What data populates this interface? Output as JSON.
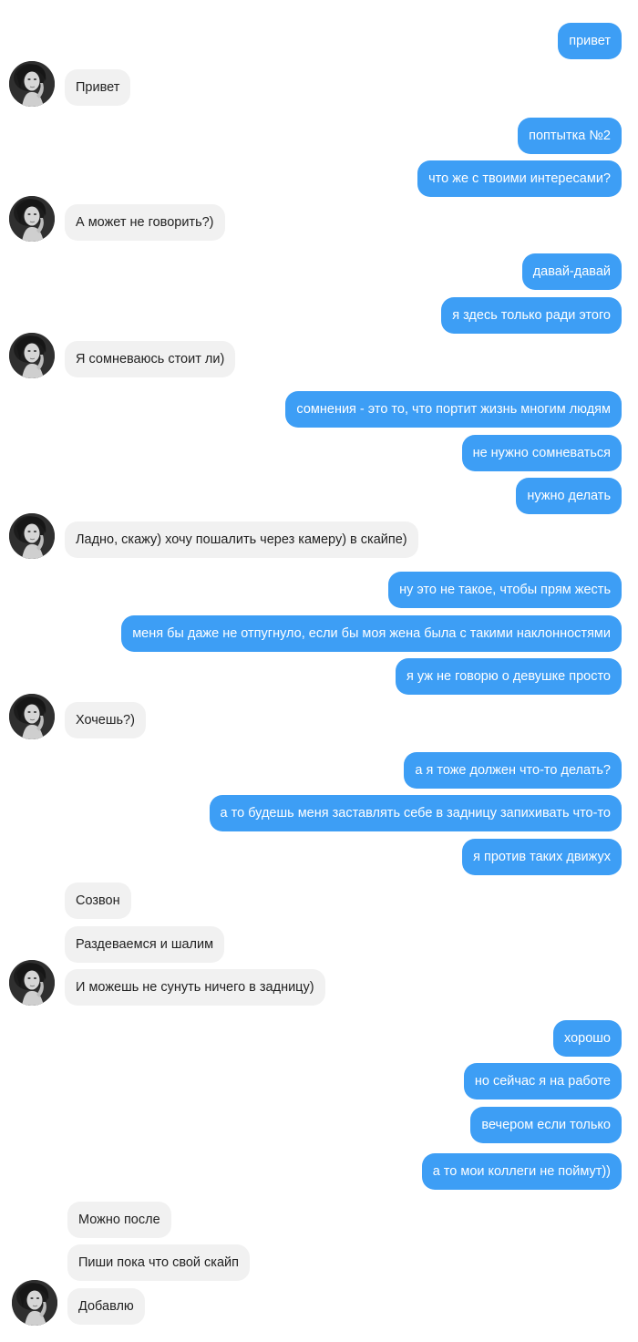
{
  "colors": {
    "outgoing": "#3d9ef5",
    "incoming": "#f1f1f1"
  },
  "messages": [
    {
      "side": "out",
      "text": "привет"
    },
    {
      "side": "in",
      "text": "Привет"
    },
    {
      "side": "out",
      "text": "поптытка №2"
    },
    {
      "side": "out",
      "text": "что же с твоими интересами?"
    },
    {
      "side": "in",
      "text": "А может не говорить?)"
    },
    {
      "side": "out",
      "text": "давай-давай"
    },
    {
      "side": "out",
      "text": "я здесь только ради этого"
    },
    {
      "side": "in",
      "text": "Я сомневаюсь стоит ли)"
    },
    {
      "side": "out",
      "text": "сомнения - это то, что портит жизнь многим людям"
    },
    {
      "side": "out",
      "text": "не нужно сомневаться"
    },
    {
      "side": "out",
      "text": "нужно делать"
    },
    {
      "side": "in",
      "text": "Ладно, скажу) хочу пошалить через камеру) в скайпе)"
    },
    {
      "side": "out",
      "text": "ну это не такое, чтобы прям жесть"
    },
    {
      "side": "out",
      "text": "меня бы даже не отпугнуло, если бы моя жена была с такими наклонностями"
    },
    {
      "side": "out",
      "text": "я уж не говорю о девушке просто"
    },
    {
      "side": "in",
      "text": "Хочешь?)"
    },
    {
      "side": "out",
      "text": "а я тоже должен что-то делать?"
    },
    {
      "side": "out",
      "text": "а то будешь меня заставлять себе в задницу запихивать что-то"
    },
    {
      "side": "out",
      "text": "я против таких движух"
    },
    {
      "side": "in",
      "text": "Созвон"
    },
    {
      "side": "in",
      "text": "Раздеваемся и шалим"
    },
    {
      "side": "in",
      "text": "И можешь не сунуть ничего в задницу)"
    },
    {
      "side": "out",
      "text": "хорошо"
    },
    {
      "side": "out",
      "text": "но сейчас я на работе"
    },
    {
      "side": "out",
      "text": "вечером если только"
    },
    {
      "side": "out",
      "text": "а то мои коллеги не поймут))"
    },
    {
      "side": "in",
      "text": "Можно после"
    },
    {
      "side": "in",
      "text": "Пиши пока что свой скайп"
    },
    {
      "side": "in",
      "text": "Добавлю"
    }
  ],
  "avatars": [
    {
      "name": "contact-avatar",
      "icon": "user-photo"
    },
    {
      "name": "contact-avatar",
      "icon": "user-photo"
    },
    {
      "name": "contact-avatar",
      "icon": "user-photo"
    },
    {
      "name": "contact-avatar",
      "icon": "user-photo"
    },
    {
      "name": "contact-avatar",
      "icon": "user-photo"
    },
    {
      "name": "contact-avatar",
      "icon": "user-photo"
    },
    {
      "name": "contact-avatar",
      "icon": "user-photo"
    }
  ]
}
